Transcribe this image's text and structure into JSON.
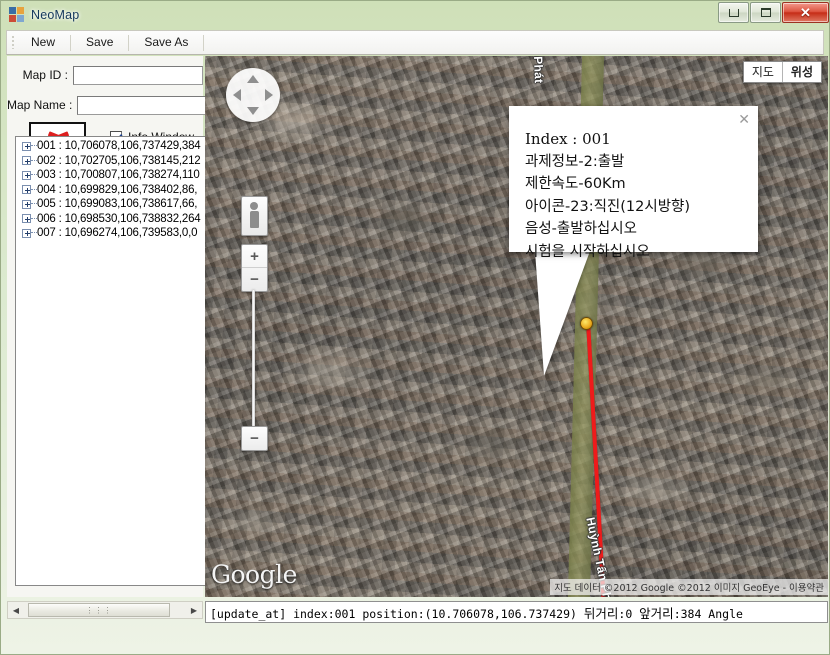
{
  "window": {
    "title": "NeoMap",
    "icon": "app-grid-icon",
    "controls": {
      "minimize": "–",
      "maximize": "□",
      "close": "✕"
    }
  },
  "toolbar": {
    "items": [
      {
        "label": "New",
        "name": "new-button"
      },
      {
        "label": "Save",
        "name": "save-button"
      },
      {
        "label": "Save As",
        "name": "save-as-button"
      }
    ]
  },
  "left_panel": {
    "map_id": {
      "label": "Map ID :",
      "value": "",
      "placeholder": ""
    },
    "map_name": {
      "label": "Map Name :",
      "value": "",
      "placeholder": ""
    },
    "delete_button": {
      "icon": "red-x-icon",
      "label": ""
    },
    "info_window_checkbox": {
      "label": "Info Window",
      "checked": true
    },
    "tree_items": [
      "001 : 10,706078,106,737429,384",
      "002 : 10,702705,106,738145,212",
      "003 : 10,700807,106,738274,110",
      "004 : 10,699829,106,738402,86,",
      "005 : 10,699083,106,738617,66,",
      "006 : 10,698530,106,738832,264",
      "007 : 10,696274,106,739583,0,0"
    ],
    "scrollbar": {
      "left_arrow": "◀",
      "right_arrow": "▶",
      "thumb_grip": "⋮⋮⋮"
    }
  },
  "map": {
    "type_buttons": [
      {
        "label": "지도",
        "active": false
      },
      {
        "label": "위성",
        "active": true
      }
    ],
    "controls": {
      "pan": "pan-control",
      "pegman": "street-view-pegman",
      "zoom_in": "+",
      "zoom_out": "−"
    },
    "street_labels": [
      {
        "text": "Huỳnh Tấn Phát",
        "position": "bottom"
      },
      {
        "text": "Phát",
        "position": "top"
      }
    ],
    "logo": "Google",
    "attribution": "지도 데이터 ©2012 Google ©2012 이미지 GeoEye - 이용약관",
    "attribution_link": "이용약관",
    "marker": {
      "name": "route-start-marker",
      "color": "#e8a81c"
    },
    "route_color": "#ee1b1b",
    "info_window": {
      "close": "✕",
      "lines": [
        "Index : 001",
        "과제정보-2:출발",
        "제한속도-60Km",
        "아이콘-23:직진(12시방향)",
        "음성-출발하십시오",
        "시험을 시작하십시오"
      ]
    }
  },
  "status_bar": {
    "prefix": "[update_at] index:001 position:(10.706078,106.737429) ",
    "back_distance_label": "뒤거리",
    "back_distance_value": ":0 ",
    "front_distance_label": "앞거리",
    "front_distance_value": ":384 Angle"
  }
}
